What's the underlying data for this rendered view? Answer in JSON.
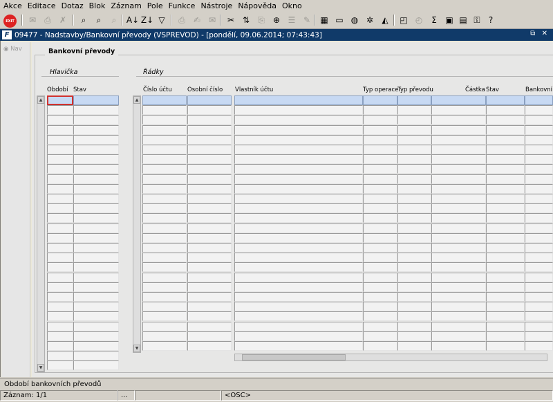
{
  "menu": [
    "Akce",
    "Editace",
    "Dotaz",
    "Blok",
    "Záznam",
    "Pole",
    "Funkce",
    "Nástroje",
    "Nápověda",
    "Okno"
  ],
  "toolbar": {
    "exit_label": "EXIT",
    "icons": [
      {
        "name": "save-icon",
        "glyph": "✉",
        "enabled": false
      },
      {
        "name": "print-icon",
        "glyph": "⎙",
        "enabled": false
      },
      {
        "name": "clear-icon",
        "glyph": "✗",
        "enabled": false
      },
      {
        "name": "enter-query-icon",
        "glyph": "⌕",
        "enabled": true
      },
      {
        "name": "execute-query-icon",
        "glyph": "⌕",
        "enabled": true
      },
      {
        "name": "cancel-query-icon",
        "glyph": "⌕",
        "enabled": false
      },
      {
        "name": "sort-ascending-icon",
        "glyph": "A↓",
        "enabled": true
      },
      {
        "name": "sort-descending-icon",
        "glyph": "Z↓",
        "enabled": true
      },
      {
        "name": "filter-icon",
        "glyph": "▽",
        "enabled": true
      },
      {
        "name": "print-preview-icon",
        "glyph": "⎙",
        "enabled": false
      },
      {
        "name": "export-icon",
        "glyph": "✍",
        "enabled": false
      },
      {
        "name": "mail-icon",
        "glyph": "✉",
        "enabled": false
      },
      {
        "name": "cut-icon",
        "glyph": "✂",
        "enabled": true
      },
      {
        "name": "paste-icon",
        "glyph": "⇅",
        "enabled": true
      },
      {
        "name": "copy-icon",
        "glyph": "⎘",
        "enabled": false
      },
      {
        "name": "zoom-icon",
        "glyph": "⊕",
        "enabled": true
      },
      {
        "name": "list-icon",
        "glyph": "☰",
        "enabled": false
      },
      {
        "name": "edit-icon",
        "glyph": "✎",
        "enabled": false
      },
      {
        "name": "calendar-icon",
        "glyph": "▦",
        "enabled": true
      },
      {
        "name": "document-icon",
        "glyph": "▭",
        "enabled": true
      },
      {
        "name": "globe-icon",
        "glyph": "◍",
        "enabled": true
      },
      {
        "name": "gear-icon",
        "glyph": "✲",
        "enabled": true
      },
      {
        "name": "chart-icon",
        "glyph": "◭",
        "enabled": true
      },
      {
        "name": "window-icon",
        "glyph": "◰",
        "enabled": true
      },
      {
        "name": "clock-icon",
        "glyph": "◴",
        "enabled": false
      },
      {
        "name": "sum-icon",
        "glyph": "Σ",
        "enabled": true
      },
      {
        "name": "excel-icon",
        "glyph": "▣",
        "enabled": true
      },
      {
        "name": "word-icon",
        "glyph": "▤",
        "enabled": true
      },
      {
        "name": "lock-icon",
        "glyph": "⚿",
        "enabled": true
      },
      {
        "name": "help-icon",
        "glyph": "?",
        "enabled": true
      }
    ]
  },
  "window": {
    "logo": "F",
    "title": "09477 - Nadstavby/Bankovní převody (VSPREVOD) - [pondělí, 09.06.2014; 07:43:43]",
    "controls": "⧉ ✕"
  },
  "nav": {
    "label": "Nav"
  },
  "form": {
    "title": "Bankovní převody",
    "header_section": {
      "title": "Hlavička",
      "columns": [
        "Období",
        "Stav"
      ]
    },
    "lines_section": {
      "title": "Řádky",
      "columns": [
        "Číslo účtu",
        "Osobní číslo",
        "Vlastník účtu",
        "Typ operace",
        "Typ převodu",
        "Částka",
        "Stav",
        "Bankovní"
      ]
    }
  },
  "status": {
    "message": "Období bankovních převodů",
    "record": "Záznam: 1/1",
    "segment2": "...",
    "mode": "<OSC>"
  },
  "colors": {
    "titlebar": "#103a69",
    "selected_row": "#c7d9f3",
    "current_cell_border": "#d0322f"
  }
}
